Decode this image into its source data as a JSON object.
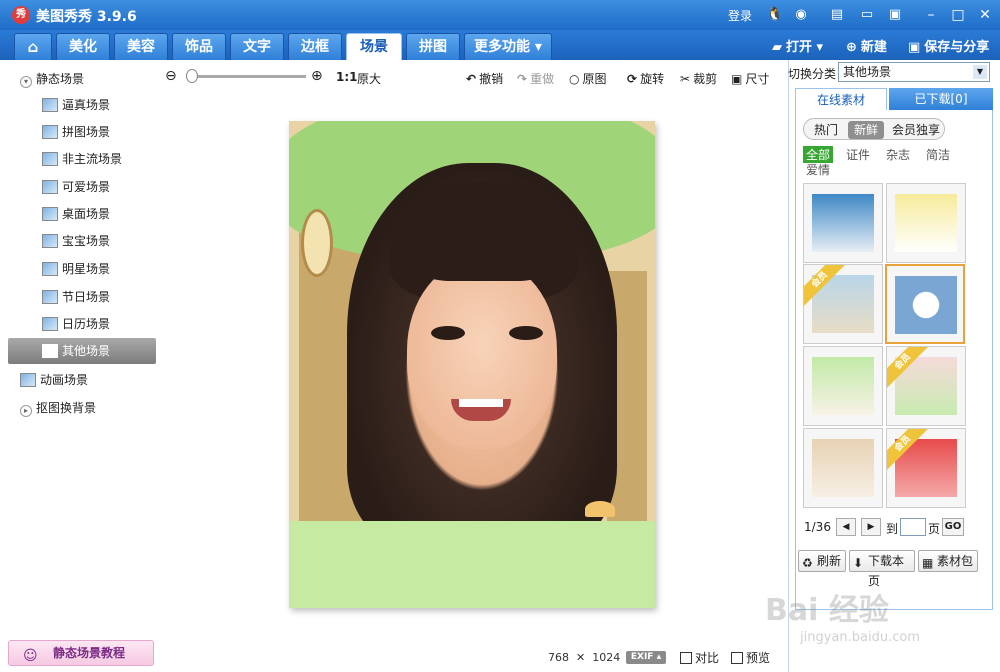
{
  "app": {
    "title": "美图秀秀 3.9.6",
    "logo_text": "秀"
  },
  "titlebar": {
    "login": "登录",
    "icons": [
      "qq-icon",
      "weibo-icon",
      "skin-icon",
      "feedback-icon",
      "menu-icon"
    ],
    "window_controls": {
      "minimize": "–",
      "maximize": "□",
      "close": "✕"
    }
  },
  "tabs": {
    "home_icon": "⌂",
    "items": [
      {
        "label": "美化"
      },
      {
        "label": "美容"
      },
      {
        "label": "饰品"
      },
      {
        "label": "文字"
      },
      {
        "label": "边框"
      },
      {
        "label": "场景",
        "active": true
      },
      {
        "label": "拼图"
      },
      {
        "label": "更多功能 ▾"
      }
    ],
    "actions": {
      "open": "打开 ▾",
      "new": "新建",
      "save_share": "保存与分享"
    }
  },
  "sidebar": {
    "static_root": "静态场景",
    "items": [
      {
        "label": "逼真场景"
      },
      {
        "label": "拼图场景"
      },
      {
        "label": "非主流场景"
      },
      {
        "label": "可爱场景"
      },
      {
        "label": "桌面场景"
      },
      {
        "label": "宝宝场景"
      },
      {
        "label": "明星场景"
      },
      {
        "label": "节日场景"
      },
      {
        "label": "日历场景"
      },
      {
        "label": "其他场景",
        "selected": true
      }
    ],
    "animated": "动画场景",
    "cutout": "抠图换背景",
    "tutorial_button": "静态场景教程"
  },
  "toolbar": {
    "zoom_ratio": "1:1",
    "actual_size": "原大",
    "undo": "撤销",
    "redo": "重做",
    "original": "原图",
    "rotate": "旋转",
    "crop": "裁剪",
    "resize": "尺寸"
  },
  "status": {
    "width": "768",
    "times": "✕",
    "height": "1024",
    "exif": "EXIF ▴",
    "compare": "对比",
    "preview": "预览"
  },
  "right_panel": {
    "switch_label": "切换分类",
    "switch_value": "其他场景",
    "tabs": {
      "online": "在线素材",
      "downloaded": "已下载[0]"
    },
    "sort_pills": {
      "hot": "热门",
      "new": "新鲜",
      "vip": "会员独享"
    },
    "filters": {
      "all": "全部",
      "id": "证件",
      "magazine": "杂志",
      "simple": "简洁",
      "love": "爱情"
    },
    "vip_ribbon": "会员",
    "pager": {
      "page_of": "1/36",
      "goto": "到",
      "page": "页",
      "go": "GO"
    },
    "buttons": {
      "refresh": "刷新",
      "download_page": "下载本页",
      "material_pack": "素材包"
    }
  },
  "watermark": {
    "line1": "Bai 经验",
    "line2": "jingyan.baidu.com"
  }
}
